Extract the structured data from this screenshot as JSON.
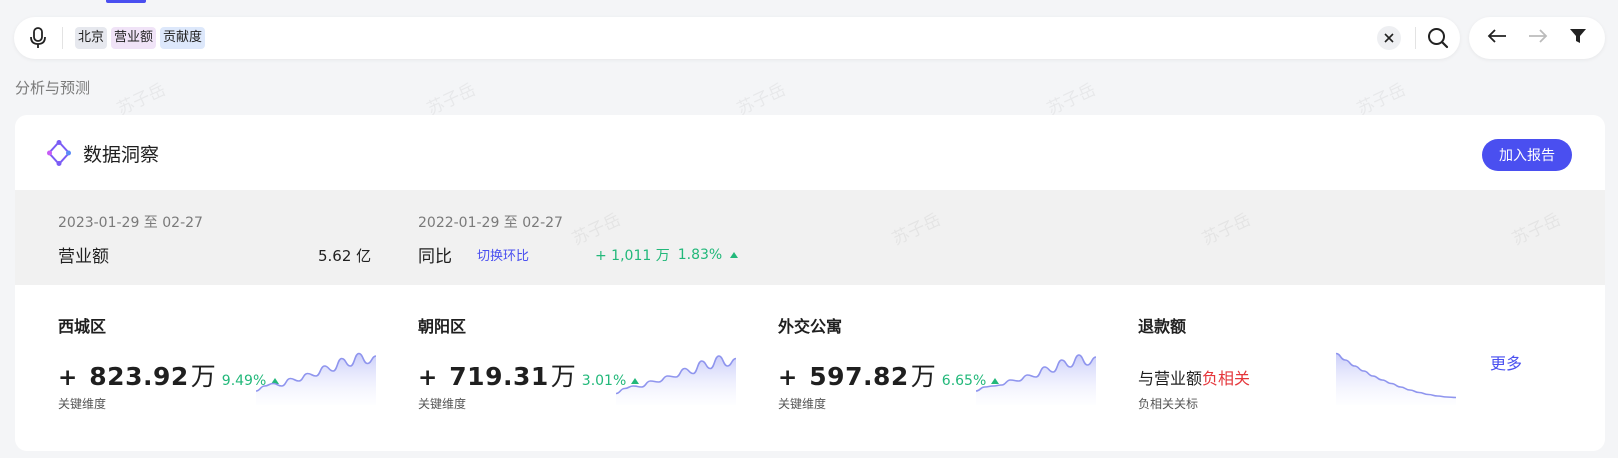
{
  "search": {
    "tags": [
      "北京",
      "营业额",
      "贡献度"
    ]
  },
  "section_title": "分析与预测",
  "card": {
    "title": "数据洞察",
    "add_report_label": "加入报告"
  },
  "summary": {
    "current_date": "2023-01-29 至 02-27",
    "current_label": "营业额",
    "current_value": "5.62 亿",
    "prev_date": "2022-01-29 至 02-27",
    "prev_label": "同比",
    "switch_label": "切换环比",
    "yoy_value": "+ 1,011 万",
    "yoy_pct": "1.83%"
  },
  "metrics": [
    {
      "name": "西城区",
      "sign": "+",
      "value": "823.92",
      "unit": "万",
      "pct": "9.49%",
      "sub": "关键维度",
      "trend": [
        0.2,
        0.3,
        0.35,
        0.3,
        0.45,
        0.4,
        0.55,
        0.5,
        0.7,
        0.6,
        0.85,
        0.7,
        0.95,
        0.75,
        0.9
      ]
    },
    {
      "name": "朝阳区",
      "sign": "+",
      "value": "719.31",
      "unit": "万",
      "pct": "3.01%",
      "sub": "关键维度",
      "trend": [
        0.15,
        0.25,
        0.3,
        0.28,
        0.4,
        0.38,
        0.5,
        0.48,
        0.65,
        0.55,
        0.8,
        0.65,
        0.9,
        0.7,
        0.85
      ]
    },
    {
      "name": "外交公寓",
      "sign": "+",
      "value": "597.82",
      "unit": "万",
      "pct": "6.65%",
      "sub": "关键维度",
      "trend": [
        0.2,
        0.28,
        0.3,
        0.32,
        0.42,
        0.4,
        0.52,
        0.48,
        0.68,
        0.58,
        0.82,
        0.68,
        0.92,
        0.72,
        0.88
      ]
    }
  ],
  "refund": {
    "name": "退款额",
    "text_prefix": "与营业额",
    "text_neg": "负相关",
    "sub": "负相关关标",
    "trend": [
      0.95,
      0.82,
      0.7,
      0.6,
      0.5,
      0.42,
      0.35,
      0.28,
      0.22,
      0.17,
      0.13,
      0.1,
      0.08,
      0.07
    ]
  },
  "more_label": "更多",
  "watermark_text": "苏子岳",
  "colors": {
    "accent": "#4a4ff0",
    "positive": "#22b87a",
    "negative": "#e5363b"
  }
}
